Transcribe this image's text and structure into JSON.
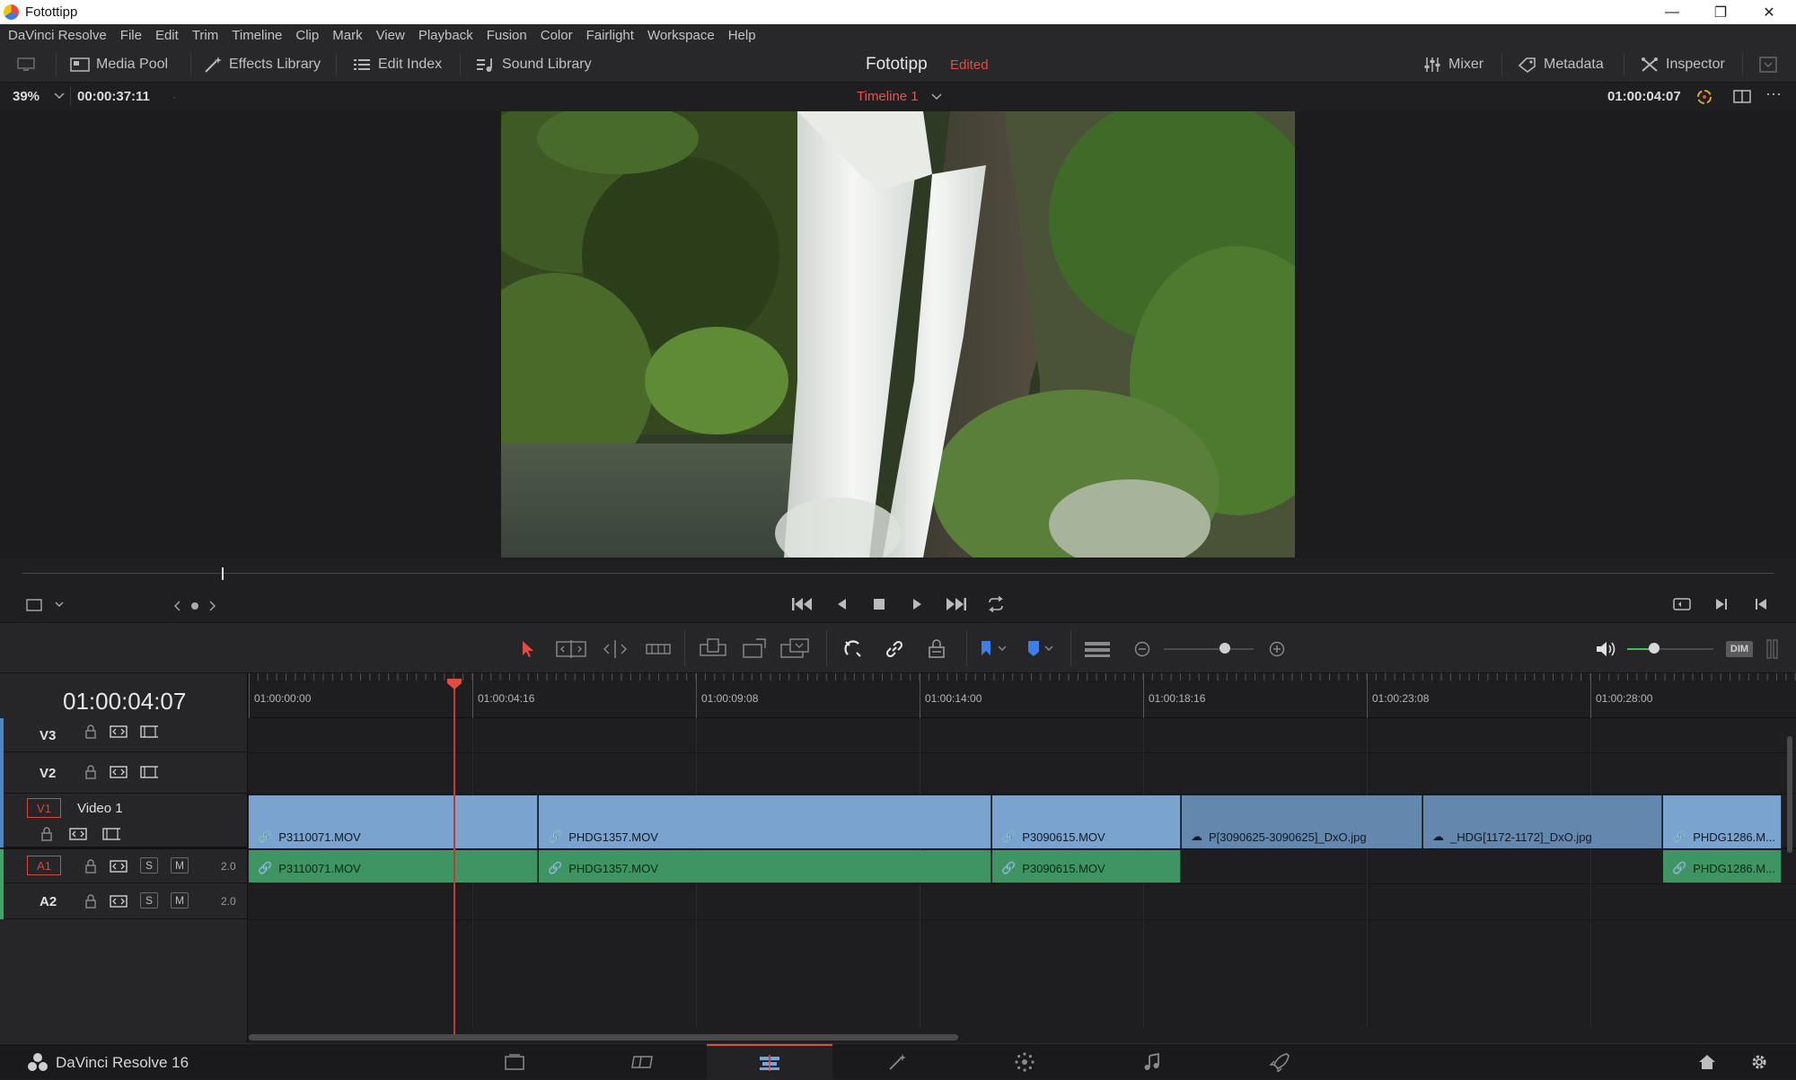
{
  "window": {
    "title": "Fotottipp"
  },
  "menu": [
    "DaVinci Resolve",
    "File",
    "Edit",
    "Trim",
    "Timeline",
    "Clip",
    "Mark",
    "View",
    "Playback",
    "Fusion",
    "Color",
    "Fairlight",
    "Workspace",
    "Help"
  ],
  "toolbar": {
    "media_pool": "Media Pool",
    "effects_library": "Effects Library",
    "edit_index": "Edit Index",
    "sound_library": "Sound Library",
    "project_title": "Fototipp",
    "project_status": "Edited",
    "mixer": "Mixer",
    "metadata": "Metadata",
    "inspector": "Inspector"
  },
  "viewer": {
    "zoom": "39%",
    "source_timecode": "00:00:37:11",
    "timeline_name": "Timeline 1",
    "record_timecode": "01:00:04:07"
  },
  "timeline": {
    "current_timecode": "01:00:04:07",
    "ruler_ticks": [
      "01:00:00:00",
      "01:00:04:16",
      "01:00:09:08",
      "01:00:14:00",
      "01:00:18:16",
      "01:00:23:08",
      "01:00:28:00"
    ],
    "tracks": {
      "v3": {
        "id": "V3"
      },
      "v2": {
        "id": "V2"
      },
      "v1": {
        "id": "V1",
        "name": "Video 1"
      },
      "a1": {
        "id": "A1",
        "solo": "S",
        "mute": "M",
        "channels": "2.0"
      },
      "a2": {
        "id": "A2",
        "solo": "S",
        "mute": "M",
        "channels": "2.0"
      }
    },
    "video_clips": [
      {
        "name": "P3110071.MOV"
      },
      {
        "name": "PHDG1357.MOV"
      },
      {
        "name": "P3090615.MOV"
      },
      {
        "name": "P[3090625-3090625]_DxO.jpg"
      },
      {
        "name": "_HDG[1172-1172]_DxO.jpg"
      },
      {
        "name": "PHDG1286.M..."
      }
    ],
    "audio_clips": [
      {
        "name": "P3110071.MOV"
      },
      {
        "name": "PHDG1357.MOV"
      },
      {
        "name": "P3090615.MOV"
      },
      {
        "name": "PHDG1286.M..."
      }
    ]
  },
  "audio_controls": {
    "dim": "DIM"
  },
  "pagebar": {
    "brand": "DaVinci Resolve 16",
    "active_page": "edit"
  }
}
